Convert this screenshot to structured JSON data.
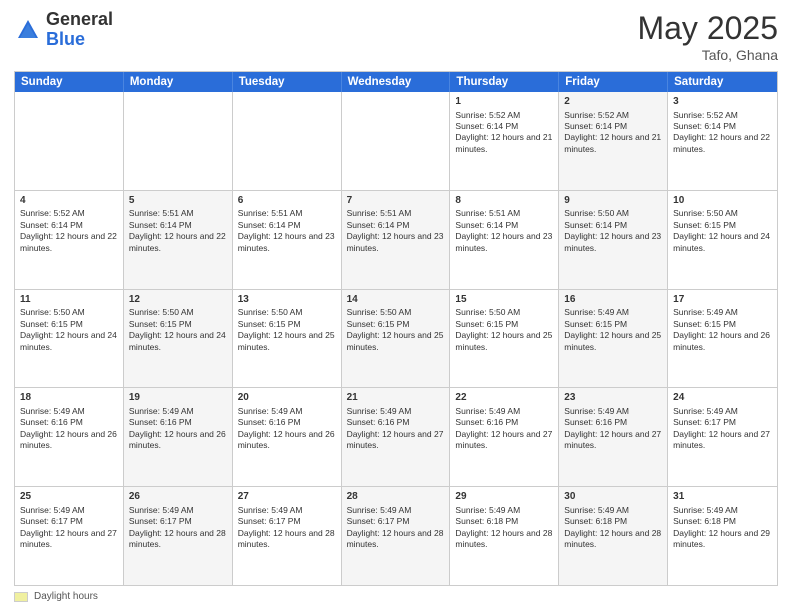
{
  "header": {
    "logo_general": "General",
    "logo_blue": "Blue",
    "month_title": "May 2025",
    "location": "Tafo, Ghana"
  },
  "footer": {
    "label": "Daylight hours"
  },
  "weekdays": [
    "Sunday",
    "Monday",
    "Tuesday",
    "Wednesday",
    "Thursday",
    "Friday",
    "Saturday"
  ],
  "rows": [
    [
      {
        "day": "",
        "info": "",
        "shaded": false
      },
      {
        "day": "",
        "info": "",
        "shaded": false
      },
      {
        "day": "",
        "info": "",
        "shaded": false
      },
      {
        "day": "",
        "info": "",
        "shaded": false
      },
      {
        "day": "1",
        "info": "Sunrise: 5:52 AM\nSunset: 6:14 PM\nDaylight: 12 hours and 21 minutes.",
        "shaded": false
      },
      {
        "day": "2",
        "info": "Sunrise: 5:52 AM\nSunset: 6:14 PM\nDaylight: 12 hours and 21 minutes.",
        "shaded": true
      },
      {
        "day": "3",
        "info": "Sunrise: 5:52 AM\nSunset: 6:14 PM\nDaylight: 12 hours and 22 minutes.",
        "shaded": false
      }
    ],
    [
      {
        "day": "4",
        "info": "Sunrise: 5:52 AM\nSunset: 6:14 PM\nDaylight: 12 hours and 22 minutes.",
        "shaded": false
      },
      {
        "day": "5",
        "info": "Sunrise: 5:51 AM\nSunset: 6:14 PM\nDaylight: 12 hours and 22 minutes.",
        "shaded": true
      },
      {
        "day": "6",
        "info": "Sunrise: 5:51 AM\nSunset: 6:14 PM\nDaylight: 12 hours and 23 minutes.",
        "shaded": false
      },
      {
        "day": "7",
        "info": "Sunrise: 5:51 AM\nSunset: 6:14 PM\nDaylight: 12 hours and 23 minutes.",
        "shaded": true
      },
      {
        "day": "8",
        "info": "Sunrise: 5:51 AM\nSunset: 6:14 PM\nDaylight: 12 hours and 23 minutes.",
        "shaded": false
      },
      {
        "day": "9",
        "info": "Sunrise: 5:50 AM\nSunset: 6:14 PM\nDaylight: 12 hours and 23 minutes.",
        "shaded": true
      },
      {
        "day": "10",
        "info": "Sunrise: 5:50 AM\nSunset: 6:15 PM\nDaylight: 12 hours and 24 minutes.",
        "shaded": false
      }
    ],
    [
      {
        "day": "11",
        "info": "Sunrise: 5:50 AM\nSunset: 6:15 PM\nDaylight: 12 hours and 24 minutes.",
        "shaded": false
      },
      {
        "day": "12",
        "info": "Sunrise: 5:50 AM\nSunset: 6:15 PM\nDaylight: 12 hours and 24 minutes.",
        "shaded": true
      },
      {
        "day": "13",
        "info": "Sunrise: 5:50 AM\nSunset: 6:15 PM\nDaylight: 12 hours and 25 minutes.",
        "shaded": false
      },
      {
        "day": "14",
        "info": "Sunrise: 5:50 AM\nSunset: 6:15 PM\nDaylight: 12 hours and 25 minutes.",
        "shaded": true
      },
      {
        "day": "15",
        "info": "Sunrise: 5:50 AM\nSunset: 6:15 PM\nDaylight: 12 hours and 25 minutes.",
        "shaded": false
      },
      {
        "day": "16",
        "info": "Sunrise: 5:49 AM\nSunset: 6:15 PM\nDaylight: 12 hours and 25 minutes.",
        "shaded": true
      },
      {
        "day": "17",
        "info": "Sunrise: 5:49 AM\nSunset: 6:15 PM\nDaylight: 12 hours and 26 minutes.",
        "shaded": false
      }
    ],
    [
      {
        "day": "18",
        "info": "Sunrise: 5:49 AM\nSunset: 6:16 PM\nDaylight: 12 hours and 26 minutes.",
        "shaded": false
      },
      {
        "day": "19",
        "info": "Sunrise: 5:49 AM\nSunset: 6:16 PM\nDaylight: 12 hours and 26 minutes.",
        "shaded": true
      },
      {
        "day": "20",
        "info": "Sunrise: 5:49 AM\nSunset: 6:16 PM\nDaylight: 12 hours and 26 minutes.",
        "shaded": false
      },
      {
        "day": "21",
        "info": "Sunrise: 5:49 AM\nSunset: 6:16 PM\nDaylight: 12 hours and 27 minutes.",
        "shaded": true
      },
      {
        "day": "22",
        "info": "Sunrise: 5:49 AM\nSunset: 6:16 PM\nDaylight: 12 hours and 27 minutes.",
        "shaded": false
      },
      {
        "day": "23",
        "info": "Sunrise: 5:49 AM\nSunset: 6:16 PM\nDaylight: 12 hours and 27 minutes.",
        "shaded": true
      },
      {
        "day": "24",
        "info": "Sunrise: 5:49 AM\nSunset: 6:17 PM\nDaylight: 12 hours and 27 minutes.",
        "shaded": false
      }
    ],
    [
      {
        "day": "25",
        "info": "Sunrise: 5:49 AM\nSunset: 6:17 PM\nDaylight: 12 hours and 27 minutes.",
        "shaded": false
      },
      {
        "day": "26",
        "info": "Sunrise: 5:49 AM\nSunset: 6:17 PM\nDaylight: 12 hours and 28 minutes.",
        "shaded": true
      },
      {
        "day": "27",
        "info": "Sunrise: 5:49 AM\nSunset: 6:17 PM\nDaylight: 12 hours and 28 minutes.",
        "shaded": false
      },
      {
        "day": "28",
        "info": "Sunrise: 5:49 AM\nSunset: 6:17 PM\nDaylight: 12 hours and 28 minutes.",
        "shaded": true
      },
      {
        "day": "29",
        "info": "Sunrise: 5:49 AM\nSunset: 6:18 PM\nDaylight: 12 hours and 28 minutes.",
        "shaded": false
      },
      {
        "day": "30",
        "info": "Sunrise: 5:49 AM\nSunset: 6:18 PM\nDaylight: 12 hours and 28 minutes.",
        "shaded": true
      },
      {
        "day": "31",
        "info": "Sunrise: 5:49 AM\nSunset: 6:18 PM\nDaylight: 12 hours and 29 minutes.",
        "shaded": false
      }
    ]
  ]
}
